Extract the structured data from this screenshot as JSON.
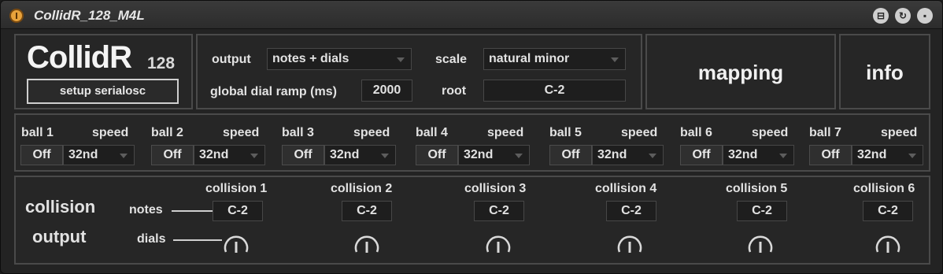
{
  "window": {
    "title": "CollidR_128_M4L",
    "icons": [
      "power-icon",
      "fold-icon",
      "refresh-icon",
      "save-icon"
    ]
  },
  "header": {
    "logo": "CollidR",
    "logo_sub": "128",
    "setup_button": "setup serialosc"
  },
  "settings": {
    "output_label": "output",
    "output_value": "notes + dials",
    "ramp_label": "global dial ramp (ms)",
    "ramp_value": "2000",
    "scale_label": "scale",
    "scale_value": "natural minor",
    "root_label": "root",
    "root_value": "C-2"
  },
  "mapping_button": "mapping",
  "info_button": "info",
  "balls": [
    {
      "label": "ball 1",
      "speed_label": "speed",
      "state": "Off",
      "speed": "32nd"
    },
    {
      "label": "ball 2",
      "speed_label": "speed",
      "state": "Off",
      "speed": "32nd"
    },
    {
      "label": "ball 3",
      "speed_label": "speed",
      "state": "Off",
      "speed": "32nd"
    },
    {
      "label": "ball 4",
      "speed_label": "speed",
      "state": "Off",
      "speed": "32nd"
    },
    {
      "label": "ball 5",
      "speed_label": "speed",
      "state": "Off",
      "speed": "32nd"
    },
    {
      "label": "ball 6",
      "speed_label": "speed",
      "state": "Off",
      "speed": "32nd"
    },
    {
      "label": "ball 7",
      "speed_label": "speed",
      "state": "Off",
      "speed": "32nd"
    }
  ],
  "collision": {
    "title_line1": "collision",
    "title_line2": "output",
    "notes_label": "notes",
    "dials_label": "dials",
    "items": [
      {
        "label": "collision 1",
        "note": "C-2"
      },
      {
        "label": "collision 2",
        "note": "C-2"
      },
      {
        "label": "collision 3",
        "note": "C-2"
      },
      {
        "label": "collision 4",
        "note": "C-2"
      },
      {
        "label": "collision 5",
        "note": "C-2"
      },
      {
        "label": "collision 6",
        "note": "C-2"
      }
    ]
  },
  "colors": {
    "accent": "#e8a23b",
    "panel_border": "#4a4a4a",
    "background": "#232323"
  }
}
